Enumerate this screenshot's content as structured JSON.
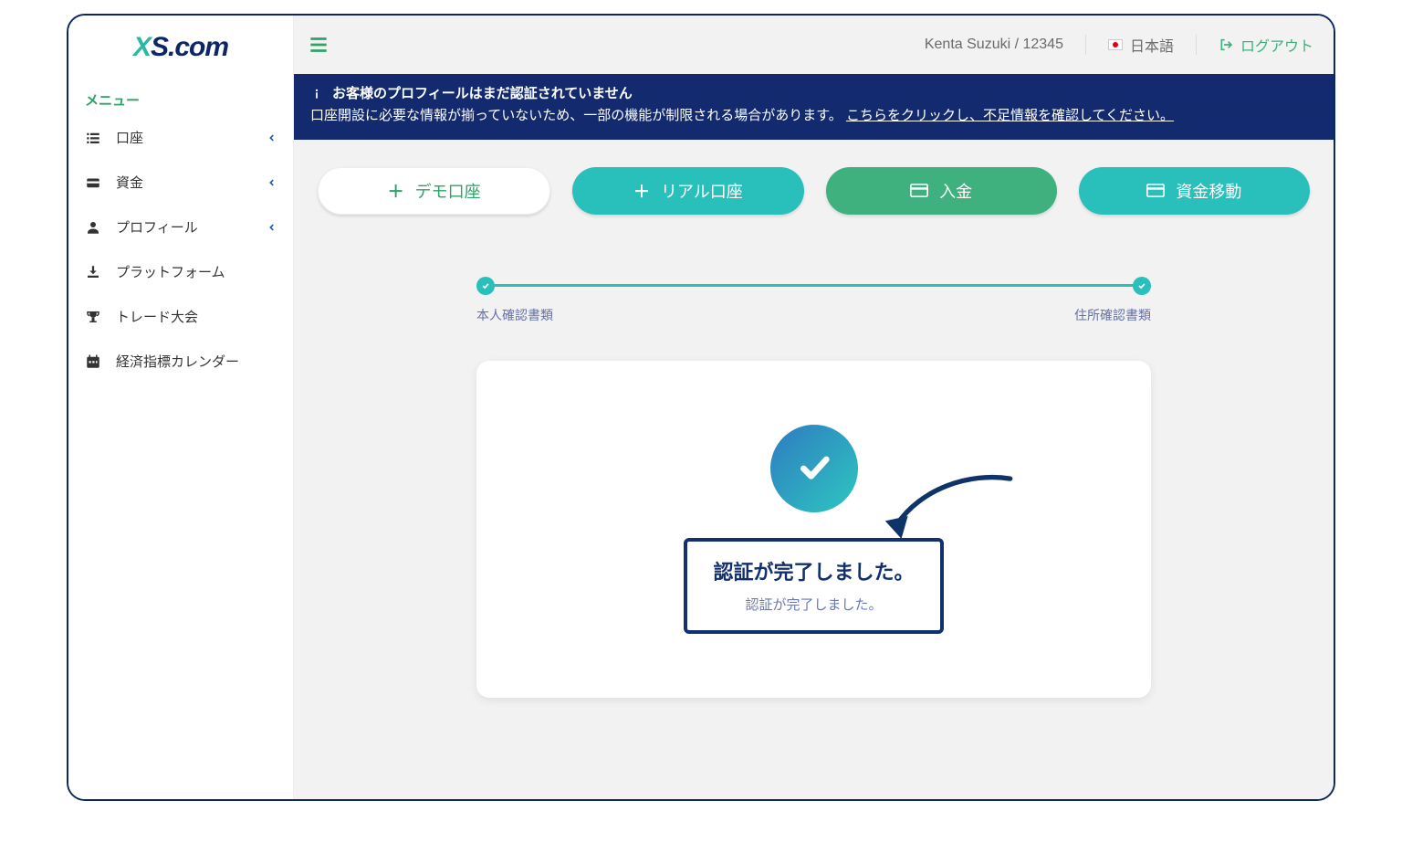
{
  "logo": {
    "text": "XS.com"
  },
  "sidebar": {
    "menu_label": "メニュー",
    "items": [
      {
        "label": "口座",
        "icon": "list-icon",
        "expandable": true
      },
      {
        "label": "資金",
        "icon": "wallet-icon",
        "expandable": true
      },
      {
        "label": "プロフィール",
        "icon": "user-icon",
        "expandable": true
      },
      {
        "label": "プラットフォーム",
        "icon": "download-icon",
        "expandable": false
      },
      {
        "label": "トレード大会",
        "icon": "trophy-icon",
        "expandable": false
      },
      {
        "label": "経済指標カレンダー",
        "icon": "calendar-icon",
        "expandable": false
      }
    ]
  },
  "header": {
    "user": "Kenta Suzuki / 12345",
    "language": "日本語",
    "logout": "ログアウト"
  },
  "alert": {
    "title": "お客様のプロフィールはまだ認証されていません",
    "body_plain": "口座開設に必要な情報が揃っていないため、一部の機能が制限される場合があります。",
    "link": "こちらをクリックし、不足情報を確認してください。"
  },
  "actions": {
    "demo": "デモ口座",
    "real": "リアル口座",
    "deposit": "入金",
    "transfer": "資金移動"
  },
  "stepper": {
    "left": "本人確認書類",
    "right": "住所確認書類"
  },
  "card": {
    "title": "認証が完了しました。",
    "subtitle": "認証が完了しました。"
  }
}
